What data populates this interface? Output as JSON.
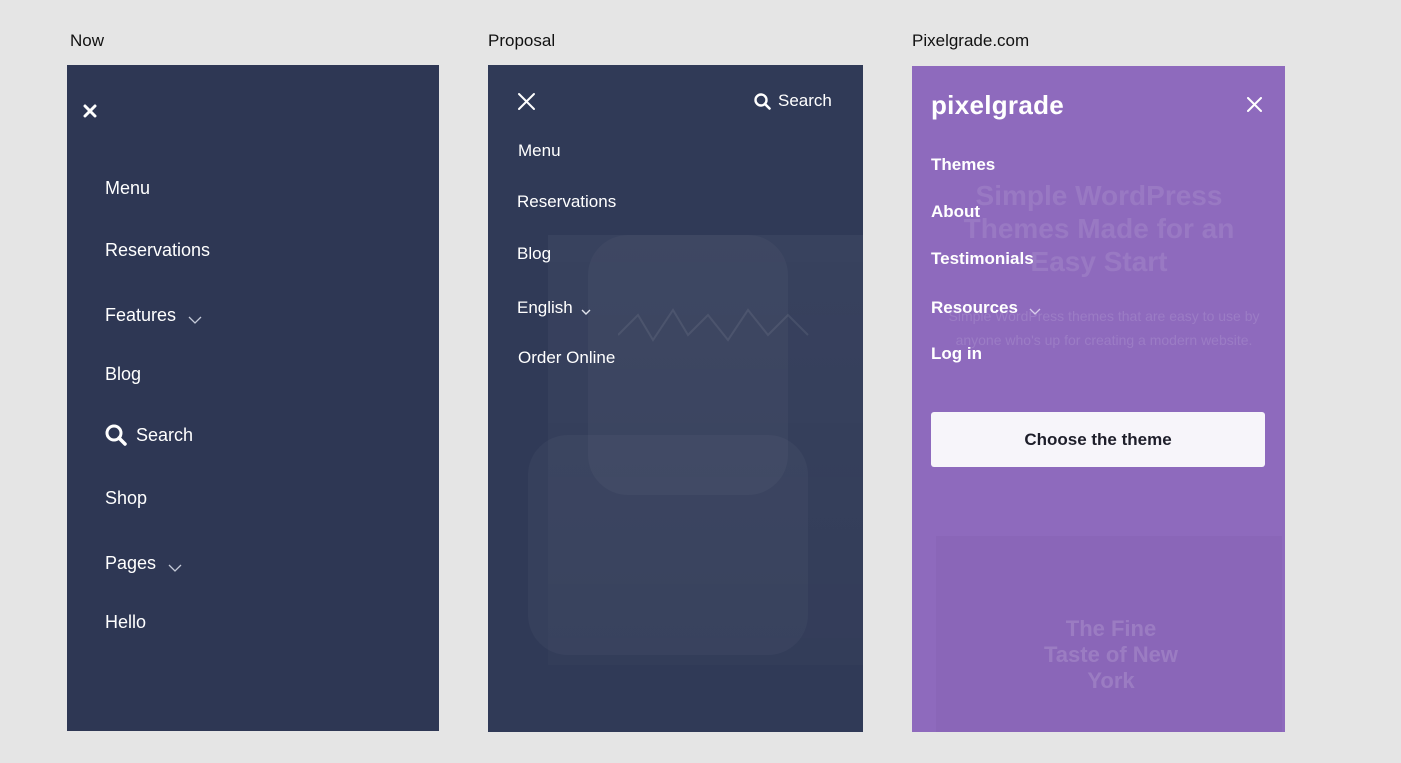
{
  "labels": {
    "now": "Now",
    "proposal": "Proposal",
    "pixelgrade": "Pixelgrade.com"
  },
  "now": {
    "items": [
      "Menu",
      "Reservations",
      "Features",
      "Blog",
      "Search",
      "Shop",
      "Pages",
      "Hello"
    ]
  },
  "proposal": {
    "search": "Search",
    "items": [
      "Menu",
      "Reservations",
      "Blog",
      "English",
      "Order Online"
    ]
  },
  "pixelgrade": {
    "logo": "pixelgrade",
    "items": [
      "Themes",
      "About",
      "Testimonials",
      "Resources",
      "Log in"
    ],
    "button": "Choose the theme",
    "bg_title": "Simple WordPress Themes Made for an Easy Start",
    "bg_sub": "Simple WordPress themes that are easy to use by anyone who's up for creating a modern website.",
    "bg_img_caption": "The Fine Taste of New York"
  },
  "colors": {
    "page_bg": "#e5e5e5",
    "now_panel": "#2e3754",
    "proposal_panel": "#303a57",
    "pixelgrade_panel": "#8e6abd"
  }
}
